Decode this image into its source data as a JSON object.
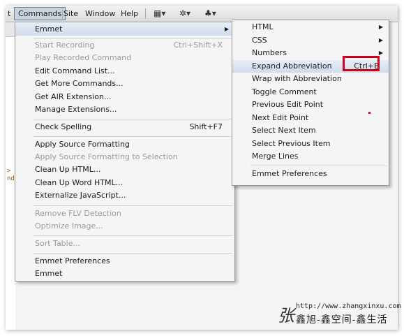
{
  "menubar": {
    "items": [
      {
        "label": "t"
      },
      {
        "label": "Commands"
      },
      {
        "label": "Site"
      },
      {
        "label": "Window"
      },
      {
        "label": "Help"
      }
    ],
    "icons": [
      "layout-icon",
      "gear-icon",
      "sitemap-icon"
    ]
  },
  "code_fragment": [
    ">",
    "nd"
  ],
  "commands_menu": {
    "items": [
      {
        "label": "Emmet",
        "submenu": true,
        "highlighted": true
      },
      {
        "label": "Start Recording",
        "shortcut": "Ctrl+Shift+X",
        "disabled": true
      },
      {
        "label": "Play Recorded Command",
        "disabled": true
      },
      {
        "label": "Edit Command List..."
      },
      {
        "label": "Get More Commands..."
      },
      {
        "label": "Get AIR Extension..."
      },
      {
        "label": "Manage Extensions..."
      },
      {
        "label": "Check Spelling",
        "shortcut": "Shift+F7"
      },
      {
        "label": "Apply Source Formatting"
      },
      {
        "label": "Apply Source Formatting to Selection",
        "disabled": true
      },
      {
        "label": "Clean Up HTML..."
      },
      {
        "label": "Clean Up Word HTML..."
      },
      {
        "label": "Externalize JavaScript..."
      },
      {
        "label": "Remove FLV Detection",
        "disabled": true
      },
      {
        "label": "Optimize Image...",
        "disabled": true
      },
      {
        "label": "Sort Table...",
        "disabled": true
      },
      {
        "label": "Emmet Preferences"
      },
      {
        "label": "Emmet"
      }
    ]
  },
  "emmet_submenu": {
    "items": [
      {
        "label": "HTML",
        "submenu": true
      },
      {
        "label": "CSS",
        "submenu": true
      },
      {
        "label": "Numbers",
        "submenu": true
      },
      {
        "label": "Expand Abbreviation",
        "shortcut": "Ctrl+E",
        "highlighted": true
      },
      {
        "label": "Wrap with Abbreviation"
      },
      {
        "label": "Toggle Comment"
      },
      {
        "label": "Previous Edit Point"
      },
      {
        "label": "Next Edit Point"
      },
      {
        "label": "Select Next Item"
      },
      {
        "label": "Select Previous Item"
      },
      {
        "label": "Merge Lines"
      },
      {
        "label": "Emmet Preferences"
      }
    ]
  },
  "watermark": {
    "signature": "张",
    "url": "http://www.zhangxinxu.com",
    "name": "鑫旭-鑫空间-鑫生活"
  },
  "colors": {
    "highlight": "#cfdcec",
    "annotation_red": "#d0021b",
    "disabled_text": "#9a9a9a"
  }
}
